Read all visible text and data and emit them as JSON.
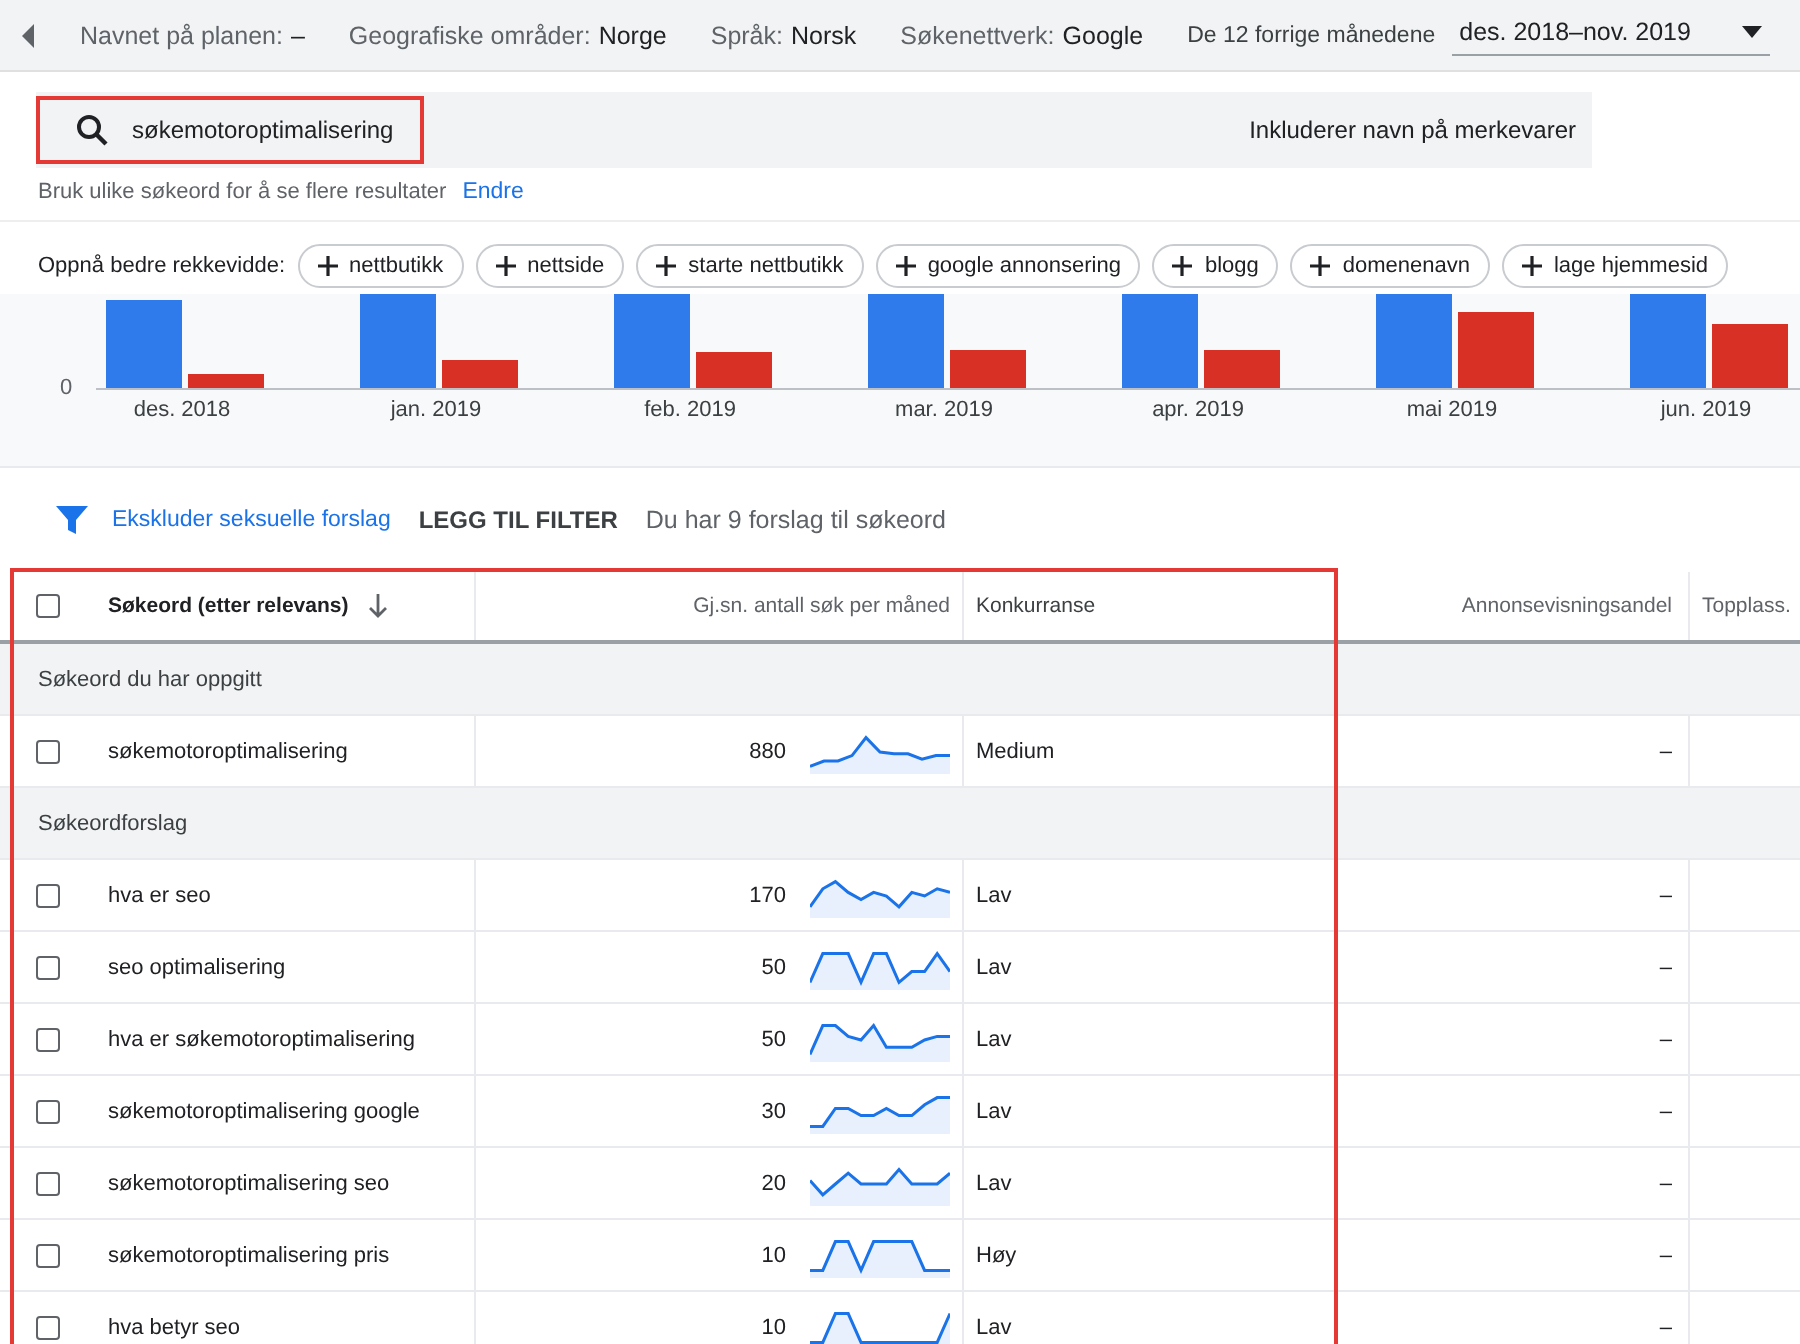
{
  "topbar": {
    "fields": [
      {
        "label": "Navnet på planen:",
        "value": "–"
      },
      {
        "label": "Geografiske områder:",
        "value": "Norge"
      },
      {
        "label": "Språk:",
        "value": "Norsk"
      },
      {
        "label": "Søkenettverk:",
        "value": "Google"
      }
    ],
    "date_range": {
      "label": "De 12 forrige månedene",
      "value": "des. 2018–nov. 2019"
    }
  },
  "search": {
    "value": "søkemotoroptimalisering",
    "brand_option": "Inkluderer navn på merkevarer"
  },
  "hint": {
    "text": "Bruk ulike søkeord for å se flere resultater",
    "link": "Endre"
  },
  "suggestions": {
    "label": "Oppnå bedre rekkevidde:",
    "chips": [
      "nettbutikk",
      "nettside",
      "starte nettbutikk",
      "google annonsering",
      "blogg",
      "domenenavn",
      "lage hjemmesid"
    ]
  },
  "chart": {
    "zero_label": "0",
    "months": [
      "des. 2018",
      "jan. 2019",
      "feb. 2019",
      "mar. 2019",
      "apr. 2019",
      "mai 2019",
      "jun. 2019"
    ]
  },
  "filter": {
    "link": "Ekskluder seksuelle forslag",
    "add_filter": "LEGG TIL FILTER",
    "count_text": "Du har 9 forslag til søkeord"
  },
  "table": {
    "header_checked": false,
    "columns": [
      "Søkeord (etter relevans)",
      "Gj.sn. antall søk per måned",
      "Konkurranse",
      "Annonsevisningsandel",
      "Topplass."
    ],
    "groups": [
      {
        "title": "Søkeord du har oppgitt",
        "rows": [
          {
            "keyword": "søkemotoroptimalisering",
            "searches": "880",
            "competition": "Medium",
            "impression_share": "–",
            "checked": false
          }
        ]
      },
      {
        "title": "Søkeordforslag",
        "rows": [
          {
            "keyword": "hva er seo",
            "searches": "170",
            "competition": "Lav",
            "impression_share": "–",
            "checked": false
          },
          {
            "keyword": "seo optimalisering",
            "searches": "50",
            "competition": "Lav",
            "impression_share": "–",
            "checked": false
          },
          {
            "keyword": "hva er søkemotoroptimalisering",
            "searches": "50",
            "competition": "Lav",
            "impression_share": "–",
            "checked": false
          },
          {
            "keyword": "søkemotoroptimalisering google",
            "searches": "30",
            "competition": "Lav",
            "impression_share": "–",
            "checked": false
          },
          {
            "keyword": "søkemotoroptimalisering seo",
            "searches": "20",
            "competition": "Lav",
            "impression_share": "–",
            "checked": false
          },
          {
            "keyword": "søkemotoroptimalisering pris",
            "searches": "10",
            "competition": "Høy",
            "impression_share": "–",
            "checked": false
          },
          {
            "keyword": "hva betyr seo",
            "searches": "10",
            "competition": "Lav",
            "impression_share": "–",
            "checked": false
          }
        ]
      }
    ]
  }
}
